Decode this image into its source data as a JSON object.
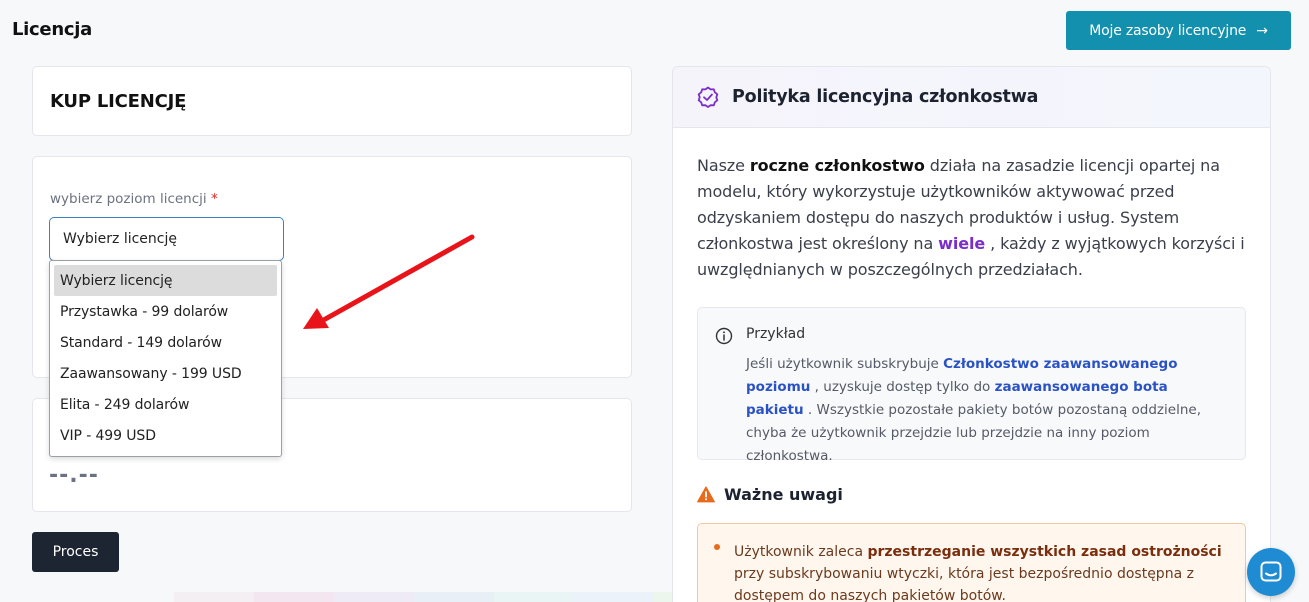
{
  "header": {
    "title": "Licencja",
    "resources_button": "Moje zasoby licencyjne",
    "resources_arrow": "→"
  },
  "buy": {
    "title": "KUP LICENCJĘ",
    "field_label": "wybierz poziom licencji",
    "required_mark": "*",
    "select_value": "Wybierz licencję",
    "options": [
      "Wybierz licencję",
      "Przystawka - 99 dolarów",
      "Standard - 149 dolarów",
      "Zaawansowany - 199 USD",
      "Elita - 249 dolarów",
      "VIP - 499 USD"
    ],
    "selected_option_index": 0,
    "price": "--.--",
    "process_button": "Proces"
  },
  "policy": {
    "title": "Polityka licencyjna członkostwa",
    "intro_1": "Nasze ",
    "intro_bold": "roczne członkostwo",
    "intro_2": " działa na zasadzie licencji opartej na modelu, który wykorzystuje użytkowników aktywować przed odzyskaniem dostępu do naszych produktów i usług. System członkostwa jest określony na ",
    "intro_wiele": "wiele",
    "intro_3": " , każdy z wyjątkowych korzyści i uwzględnianych w poszczególnych przedziałach.",
    "example_title": "Przykład",
    "example_1": "Jeśli użytkownik subskrybuje ",
    "example_link_1": "Członkostwo zaawansowanego poziomu",
    "example_2": " , uzyskuje dostęp tylko do ",
    "example_link_2": "zaawansowanego bota pakietu",
    "example_3": " . Wszystkie pozostałe pakiety botów pozostaną oddzielne, chyba że użytkownik przejdzie lub przejdzie na inny poziom członkostwa.",
    "warning_title": "Ważne uwagi",
    "note_1": "Użytkownik zaleca ",
    "note_bold": "przestrzeganie wszystkich zasad ostrożności",
    "note_2": " przy subskrybowaniu wtyczki, która jest bezpośrednio dostępna z dostępem do naszych pakietów botów."
  },
  "colors": {
    "accent": "#1390ad",
    "dark_button": "#1e2532",
    "arrow": "#e8141a",
    "purple": "#7b2fc9",
    "link_blue": "#2b52c4",
    "warning": "#e86a1c"
  },
  "icons": {
    "policy": "badge-check-icon",
    "example": "info-icon",
    "warning": "warning-triangle-icon",
    "chat": "chat-icon"
  }
}
